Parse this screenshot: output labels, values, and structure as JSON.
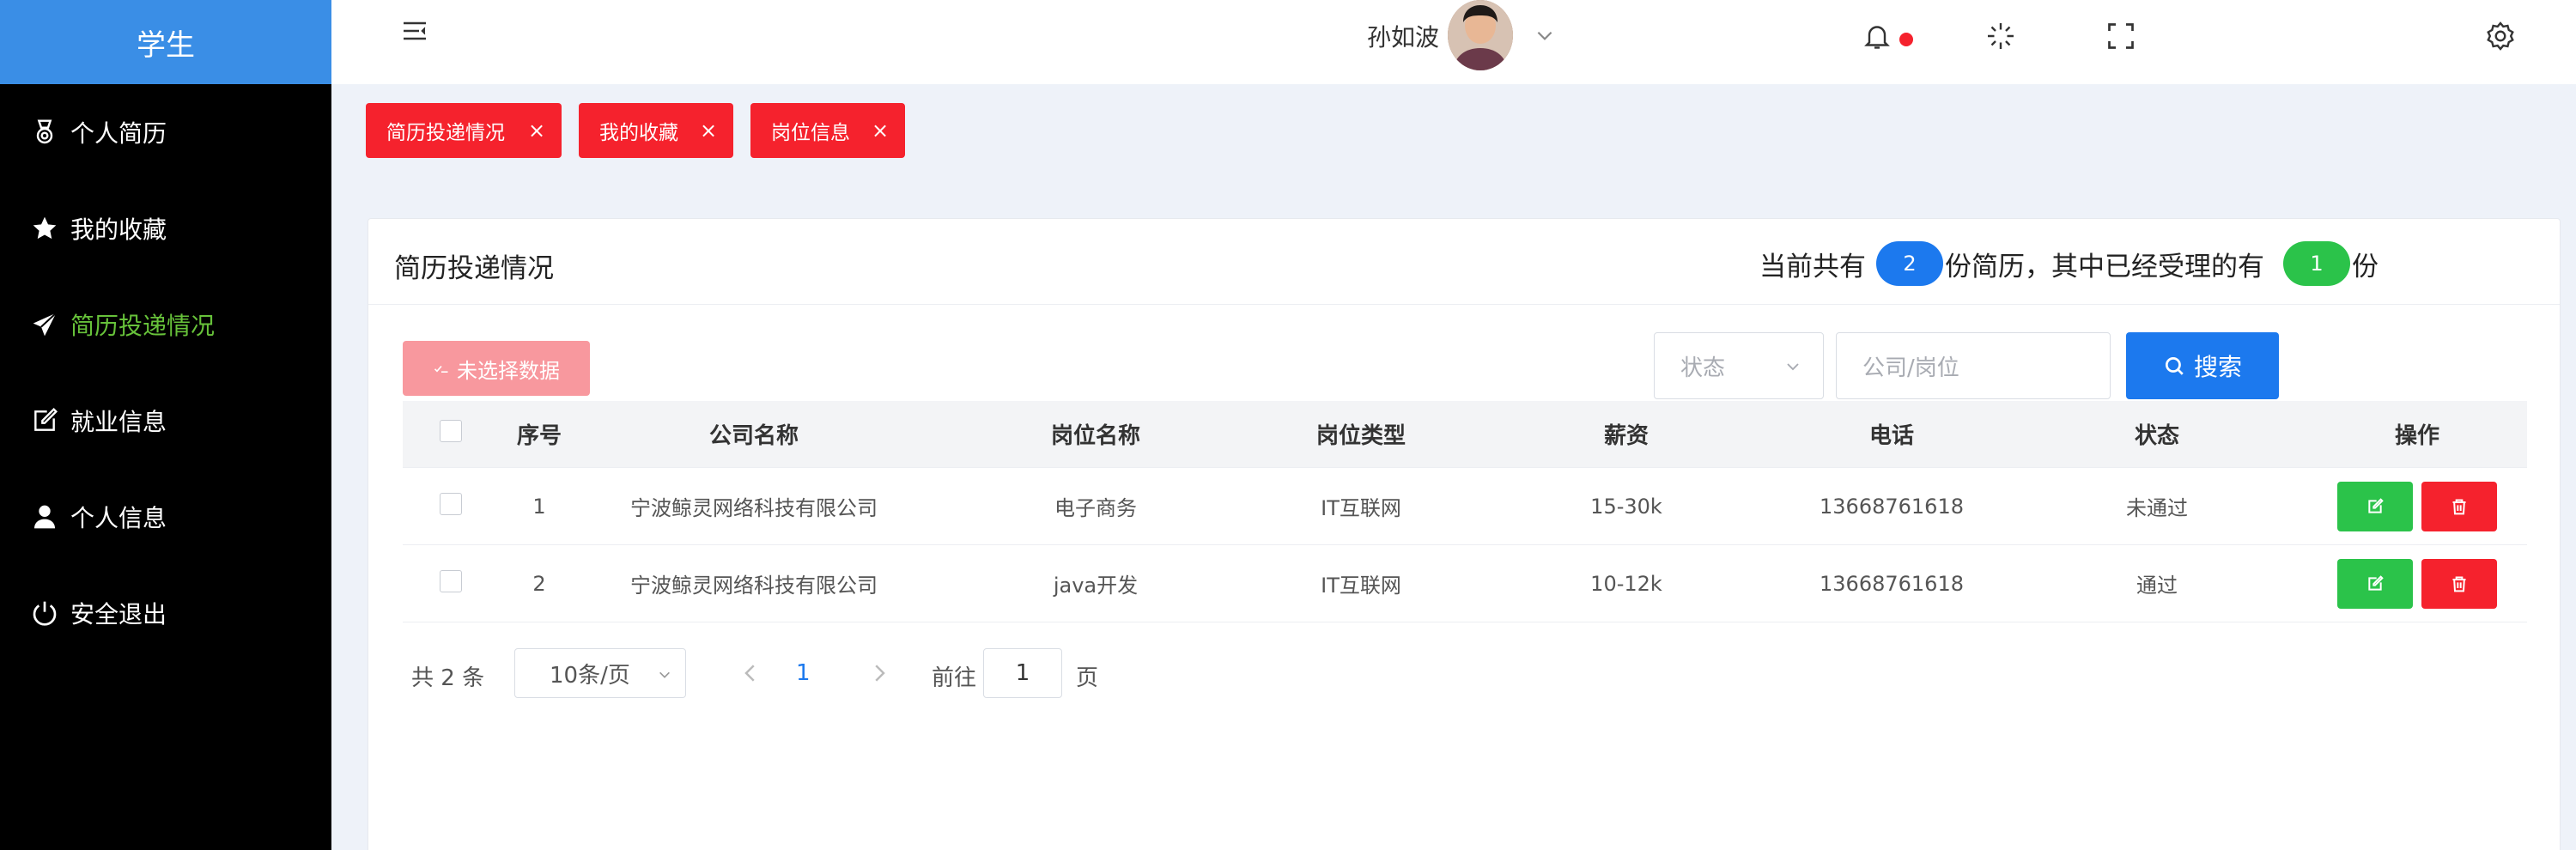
{
  "sidebar": {
    "brand": "学生",
    "items": [
      {
        "label": "个人简历",
        "icon": "medal-icon",
        "active": false
      },
      {
        "label": "我的收藏",
        "icon": "star-icon",
        "active": false
      },
      {
        "label": "简历投递情况",
        "icon": "send-icon",
        "active": true
      },
      {
        "label": "就业信息",
        "icon": "edit-icon",
        "active": false
      },
      {
        "label": "个人信息",
        "icon": "user-icon",
        "active": false
      },
      {
        "label": "安全退出",
        "icon": "power-icon",
        "active": false
      }
    ],
    "active_color": "#67c23a"
  },
  "header": {
    "username": "孙如波",
    "icons": [
      "menu-fold-icon",
      "bell-icon",
      "loading-icon",
      "fullscreen-icon",
      "chevron-down-icon",
      "settings-icon"
    ]
  },
  "tags": [
    {
      "label": "简历投递情况"
    },
    {
      "label": "我的收藏"
    },
    {
      "label": "岗位信息"
    }
  ],
  "card": {
    "title": "简历投递情况",
    "summary": {
      "prefix": "当前共有",
      "total": "2",
      "middle": "份简历，其中已经受理的有",
      "accepted": "1",
      "suffix": "份"
    }
  },
  "toolbar": {
    "selection_label": "未选择数据",
    "status_placeholder": "状态",
    "search_placeholder": "公司/岗位",
    "search_label": "搜索"
  },
  "table": {
    "columns": [
      "序号",
      "公司名称",
      "岗位名称",
      "岗位类型",
      "薪资",
      "电话",
      "状态",
      "操作"
    ],
    "rows": [
      {
        "index": "1",
        "company": "宁波鲸灵网络科技有限公司",
        "position": "电子商务",
        "type": "IT互联网",
        "salary": "15-30k",
        "phone": "13668761618",
        "status": "未通过"
      },
      {
        "index": "2",
        "company": "宁波鲸灵网络科技有限公司",
        "position": "java开发",
        "type": "IT互联网",
        "salary": "10-12k",
        "phone": "13668761618",
        "status": "通过"
      }
    ]
  },
  "pagination": {
    "total": "共 2 条",
    "page_size": "10条/页",
    "current_page": "1",
    "goto_label": "前往",
    "goto_value": "1",
    "page_unit": "页"
  },
  "colors": {
    "primary": "#1c79ee",
    "danger": "#f5222d",
    "success": "#2bc34a",
    "sidebar_bg": "#000000"
  }
}
